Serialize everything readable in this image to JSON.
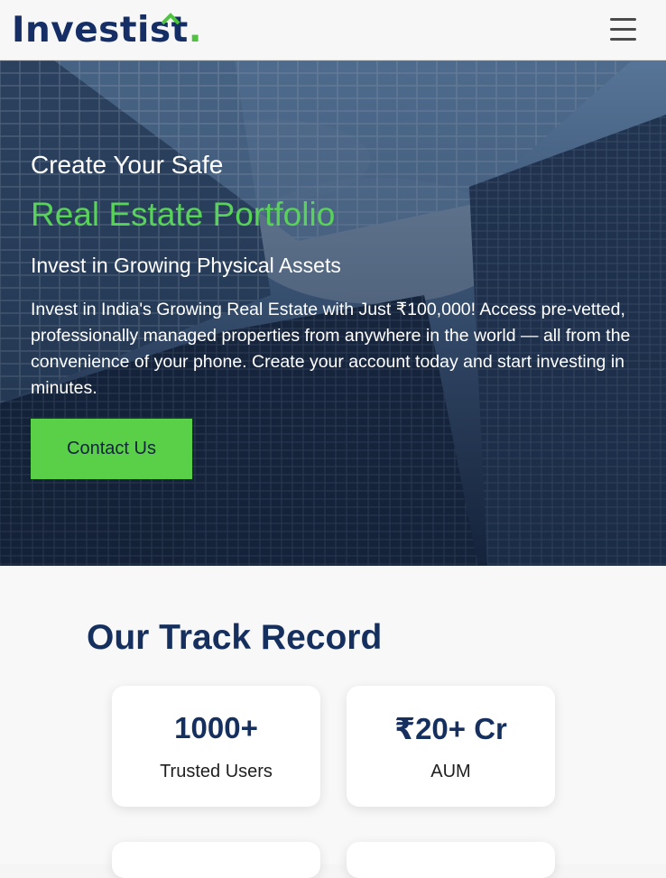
{
  "header": {
    "logo_text": "Investi",
    "logo_accent": "st",
    "logo_dot": ".",
    "menu_icon": "hamburger-menu-icon"
  },
  "hero": {
    "line1": "Create Your Safe",
    "line2": "Real Estate Portfolio",
    "line3": "Invest in Growing Physical Assets",
    "paragraph": "Invest in India's Growing Real Estate with Just ₹100,000! Access pre-vetted, professionally managed properties from anywhere in the world — all from the convenience of your phone. Create your account today and start investing in minutes.",
    "cta_label": "Contact Us"
  },
  "track_record": {
    "title": "Our Track Record",
    "stats": [
      {
        "value": "1000+",
        "label": "Trusted Users"
      },
      {
        "value": "₹20+ Cr",
        "label": "AUM"
      }
    ]
  },
  "colors": {
    "brand_navy": "#152f66",
    "brand_green": "#4fc53f",
    "cta_green": "#59d047",
    "accent_text_green": "#59d25a"
  }
}
